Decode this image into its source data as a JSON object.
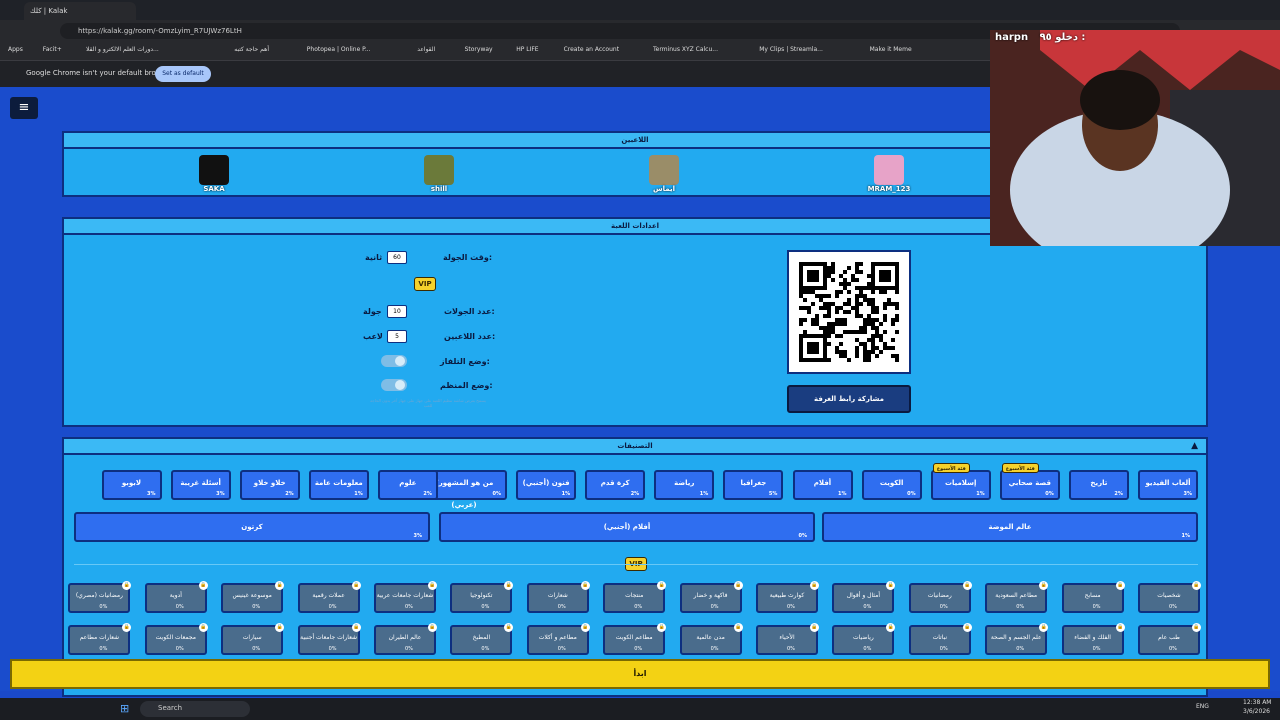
{
  "browser": {
    "tab_title": "كلك | Kalak",
    "url": "https://kalak.gg/room/-OmzLyim_R7UJWz76LtH",
    "bookmarks": [
      "Apps",
      "Facit+",
      "دورات العلم الالكترو و القلا...",
      "أهم حاجة كتبه",
      "Photopea | Online P...",
      "القواعد",
      "Storyway",
      "HP LIFE",
      "Create an Account",
      "Terminus XYZ Calcu...",
      "My Clips | Streamla...",
      "Make it Meme"
    ],
    "default_notice": "Google Chrome isn't your default browser",
    "set_default": "Set as default"
  },
  "overlay": {
    "channel": "harpn",
    "message": "دخلو ٩٥ :"
  },
  "players_panel": {
    "title": "اللاعبين",
    "players": [
      {
        "name": "SAKA",
        "color": "#111"
      },
      {
        "name": "shill",
        "color": "#6b7a3a"
      },
      {
        "name": "ايماس",
        "color": "#9a8d68"
      },
      {
        "name": "MRAM_123",
        "color": "#e7a3c8"
      }
    ]
  },
  "settings": {
    "title": "اعدادات اللعبة",
    "round_time_label": "وقت الجولة:",
    "round_time_value": "60",
    "round_time_unit": "ثانية",
    "vip": "VIP",
    "rounds_label": "عدد الجولات:",
    "rounds_value": "10",
    "rounds_unit": "جولة",
    "players_label": "عدد اللاعبين:",
    "players_value": "5",
    "players_unit": "لاعب",
    "team_mode": "وضع التلفاز:",
    "team_mode2": "وضع المنظم:",
    "note": "يسمح بعرض شاشة تنظيم اللعبة على جهاز على جهاز آخر بدون الحاجة للعب",
    "share_button": "مشاركة رابط الغرفة"
  },
  "categories": {
    "title": "التصنيفات",
    "row1": [
      {
        "label": "ألعاب الفيديو",
        "pct": "3%"
      },
      {
        "label": "تاريخ",
        "pct": "2%"
      },
      {
        "label": "قصة صحابي",
        "pct": "0%",
        "badge": "فئة الأسبوع"
      },
      {
        "label": "إسلاميات",
        "pct": "1%",
        "badge": "فئة الأسبوع"
      },
      {
        "label": "الكويت",
        "pct": "0%"
      },
      {
        "label": "أفلام",
        "pct": "1%"
      },
      {
        "label": "جغرافيا",
        "pct": "5%"
      },
      {
        "label": "رياضة",
        "pct": "1%"
      },
      {
        "label": "كرة قدم",
        "pct": "2%"
      },
      {
        "label": "فنون (أجنبي)",
        "pct": "1%"
      },
      {
        "label": "من هو المشهور؟ (عربي)",
        "pct": "0%"
      },
      {
        "label": "علوم",
        "pct": "2%"
      },
      {
        "label": "معلومات عامة",
        "pct": "1%"
      },
      {
        "label": "خلاو خلاو",
        "pct": "2%"
      },
      {
        "label": "أسئلة غريبة",
        "pct": "3%"
      },
      {
        "label": "لابوبو",
        "pct": "3%"
      }
    ],
    "row2": [
      {
        "label": "عالم الموضة",
        "pct": "1%"
      },
      {
        "label": "أفلام (أجنبي)",
        "pct": "0%"
      },
      {
        "label": "كرتون",
        "pct": "3%"
      }
    ],
    "vip": "VIP",
    "locked1": [
      "شخصيات",
      "مسابح",
      "مطاعم السعودية",
      "رمضانيات",
      "أمثال و أقوال",
      "كوارث طبيعية",
      "فاكهة و خضار",
      "منتجات",
      "شعارات",
      "تكنولوجيا",
      "شعارات جامعات عربية",
      "عملات رقمية",
      "موسوعة غينيس",
      "أدوية",
      "رمضانيات (مصري)"
    ],
    "locked2": [
      "طب عام",
      "الفلك و الفضاء",
      "علم الجسم و الصحة",
      "نباتات",
      "رياضيات",
      "الأحياء",
      "مدن عالمية",
      "مطاعم الكويت",
      "مطاعم و أكلات",
      "المطبخ",
      "عالم الطيران",
      "شعارات جامعات أجنبية",
      "سيارات",
      "مجمعات الكويت",
      "شعارات مطاعم"
    ],
    "locked_pct": "0%"
  },
  "start_button": "ابدأ",
  "taskbar": {
    "search": "Search",
    "lang": "ENG",
    "time": "12:38 AM",
    "date": "3/6/2026"
  }
}
